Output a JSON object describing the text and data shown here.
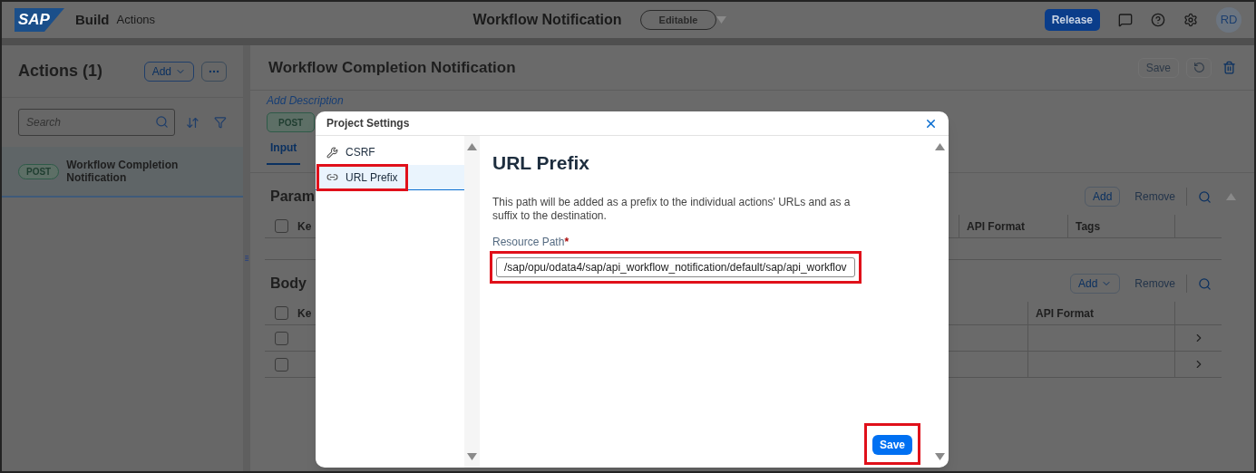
{
  "header": {
    "logo": "SAP",
    "product": "Build",
    "section": "Actions",
    "title": "Workflow Notification",
    "status": "Editable",
    "release": "Release",
    "avatar": "RD"
  },
  "actions_panel": {
    "title": "Actions (1)",
    "add": "Add",
    "search": {
      "placeholder": "Search"
    },
    "items": [
      {
        "method": "POST",
        "name": "Workflow Completion Notification",
        "selected": true
      }
    ]
  },
  "detail": {
    "title": "Workflow Completion Notification",
    "save": "Save",
    "add_description": "Add Description",
    "method": "POST",
    "tabs": [
      {
        "label": "Input",
        "selected": true
      }
    ],
    "parameters": {
      "title": "Param",
      "add": "Add",
      "remove": "Remove",
      "all_checked": false,
      "columns": [
        "Ke",
        "API Format",
        "Tags"
      ]
    },
    "body": {
      "title": "Body",
      "add": "Add",
      "remove": "Remove",
      "all_checked": false,
      "columns": [
        "Ke",
        "API Format"
      ],
      "rows": [
        {
          "checked": false
        },
        {
          "checked": false
        }
      ]
    }
  },
  "dialog": {
    "title": "Project Settings",
    "nav": [
      {
        "kind": "wrench",
        "label": "CSRF",
        "selected": false,
        "highlighted": false
      },
      {
        "kind": "link",
        "label": "URL Prefix",
        "selected": true,
        "highlighted": true
      }
    ],
    "heading": "URL Prefix",
    "description": "This path will be added as a prefix to the individual actions' URLs and as a suffix to the destination.",
    "field": {
      "label": "Resource Path",
      "required_mark": "*",
      "value": "/sap/opu/odata4/sap/api_workflow_notification/default/sap/api_workflov",
      "highlighted": true
    },
    "save": {
      "label": "Save",
      "highlighted": true
    }
  }
}
